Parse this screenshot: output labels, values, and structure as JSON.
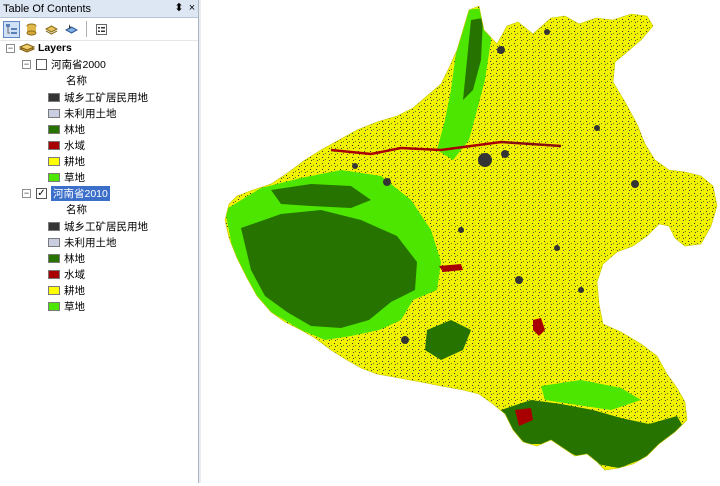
{
  "toc": {
    "title": "Table Of Contents",
    "pin_glyph": "↕",
    "close_glyph": "×",
    "toolbar": [
      {
        "icon": "list-by-drawing-order-icon"
      },
      {
        "icon": "list-by-source-icon"
      },
      {
        "icon": "list-by-visibility-icon"
      },
      {
        "icon": "list-by-selection-icon"
      },
      {
        "icon": "options-icon"
      }
    ],
    "root_label": "Layers",
    "layers": [
      {
        "name": "河南省2000",
        "checked": false,
        "field": "名称",
        "classes": [
          {
            "label": "城乡工矿居民用地",
            "color": "#343434"
          },
          {
            "label": "未利用土地",
            "color": "#c8cde0"
          },
          {
            "label": "林地",
            "color": "#267300"
          },
          {
            "label": "水域",
            "color": "#a80000"
          },
          {
            "label": "耕地",
            "color": "#ffff00"
          },
          {
            "label": "草地",
            "color": "#4ce600"
          }
        ]
      },
      {
        "name": "河南省2010",
        "checked": true,
        "selected": true,
        "field": "名称",
        "classes": [
          {
            "label": "城乡工矿居民用地",
            "color": "#343434"
          },
          {
            "label": "未利用土地",
            "color": "#c8cde0"
          },
          {
            "label": "林地",
            "color": "#267300"
          },
          {
            "label": "水域",
            "color": "#a80000"
          },
          {
            "label": "耕地",
            "color": "#ffff00"
          },
          {
            "label": "草地",
            "color": "#4ce600"
          }
        ]
      }
    ]
  },
  "colors": {
    "farmland": "#ffff00",
    "forest": "#267300",
    "grass": "#4ce600",
    "water": "#a80000",
    "urban": "#343434",
    "selection": "#3b6fc9"
  }
}
